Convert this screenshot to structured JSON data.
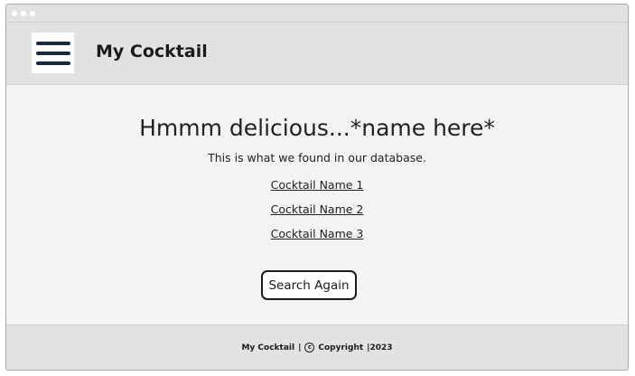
{
  "header": {
    "title": "My Cocktail",
    "menu_icon": "hamburger-menu-icon"
  },
  "main": {
    "headline": "Hmmm delicious...*name here*",
    "subtext": "This is what we found in our database.",
    "results": [
      "Cocktail Name 1",
      "Cocktail Name 2",
      "Cocktail Name 3"
    ],
    "search_again_label": "Search Again"
  },
  "footer": {
    "brand": "My Cocktail",
    "separator": "|",
    "copyright_icon": "copyright-icon",
    "copyright_label": "Copyright",
    "year": "|2023"
  },
  "colors": {
    "header_bg": "#e2e2e2",
    "content_bg": "#f5f3f2",
    "menu_bars": "#1b2940",
    "text": "#222222"
  }
}
